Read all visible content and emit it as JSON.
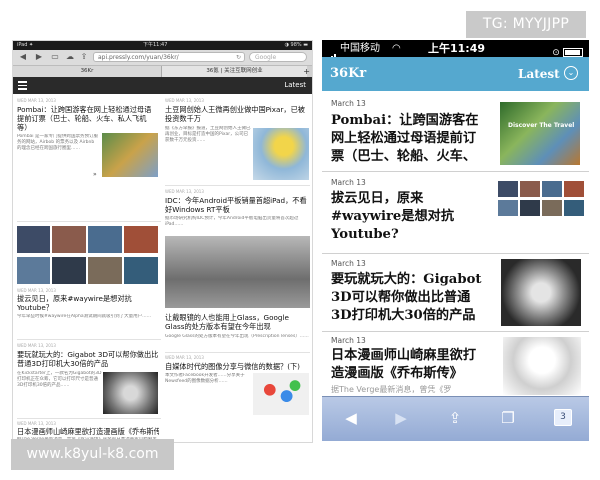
{
  "watermarks": {
    "top": "TG: MYYJJPP",
    "bottom": "www.k8yul-k8.com"
  },
  "ipad": {
    "status": {
      "left": "iPad ✦",
      "time": "下午11:47",
      "battery": "◑ 98% ▬"
    },
    "url": "api.pressly.com/yuan/36kr/",
    "search_placeholder": "Google",
    "tabs": [
      "36Kr",
      "36氪 | 关注互联网创业"
    ],
    "tab_add": "+",
    "latest": "Latest",
    "articles": [
      {
        "date": "WED MAR 13, 2013",
        "title": "Pombai：让跨国游客在网上轻松通过母语提前订票（巴士、轮船、火车、私人飞机等）",
        "excerpt": "Pombai 是一家专门提供跨国票务预订服务的网站，Airbob 的票务以及 Airbnb 的理念已经在跨国旅行圈里……"
      },
      {
        "date": "WED MAR 13, 2013",
        "title": "土豆网创始人王微再创业做中国Pixar，已被投资数千万",
        "excerpt": "据《东方早报》报道，土豆网创始人王微已再创业，目标是打造中国的Pixar，公司已获数千万元投资……"
      },
      {
        "date": "WED MAR 13, 2013",
        "title": "拔云见日，原来#waywire是想对抗Youtube？",
        "excerpt": "今年早些时候#waywire在Alpha测试期间就吸引到了大量用户……"
      },
      {
        "date": "WED MAR 13, 2013",
        "title": "IDC：今年Android平板销量首超iPad，不看好Windows RT平板",
        "excerpt": "据市场研究机构IDC预计，今年Android平板电脑出货量将首次超过iPad……"
      },
      {
        "date": "WED MAR 13, 2013",
        "title": "要玩就玩大的：Gigabot 3D可以帮你做出比普通3D打印机大30倍的产品",
        "excerpt": "在Kickstarter上，一款名为Gigabot的3D打印机正在众筹，它可以打印尺寸是普通3D打印机30倍的产品……"
      },
      {
        "date": "WED MAR 13, 2013",
        "title": "让戴眼镜的人也能用上Glass，Google Glass的处方版本有望在今年出现",
        "excerpt": "Google Glass的处方版本有望在今年出现（Prescription lenses）……"
      },
      {
        "date": "WED MAR 13, 2013",
        "title": "日本漫画师山崎麻里欲打造漫画版《乔布斯传》",
        "excerpt": "据The Verge最新消息，曾凭《罗马浴场》获奖的日本漫画家山崎麻里（Mari Yamazaki）……"
      },
      {
        "date": "WED MAR 13, 2013",
        "title": "自媒体时代的图像分享与微信的数据？(下)",
        "excerpt": "本文作者Facebook开发者……分享关于Newsfeed的图像数据分析……"
      }
    ]
  },
  "iphone": {
    "status": {
      "carrier": "中国移动",
      "time": "上午11:49"
    },
    "logo": "36Kr",
    "latest": "Latest",
    "articles": [
      {
        "date": "March 13",
        "title_lines": [
          "Pombai：让跨国游客在",
          "网上轻松通过母语提前订",
          "票（巴士、轮船、火车、"
        ]
      },
      {
        "date": "March 13",
        "title_lines": [
          "拔云见日，原来",
          "#waywire是想对抗",
          "Youtube?"
        ]
      },
      {
        "date": "March 13",
        "title_lines": [
          "要玩就玩大的：Gigabot",
          "3D可以帮你做出比普通",
          "3D打印机大30倍的产品"
        ]
      },
      {
        "date": "March 13",
        "title_lines": [
          "日本漫画师山崎麻里欲打",
          "造漫画版《乔布斯传》"
        ],
        "excerpt": "据The Verge最新消息，曾凭《罗"
      }
    ],
    "thumb_caption": "Discover The Travel",
    "pages_count": "3"
  }
}
